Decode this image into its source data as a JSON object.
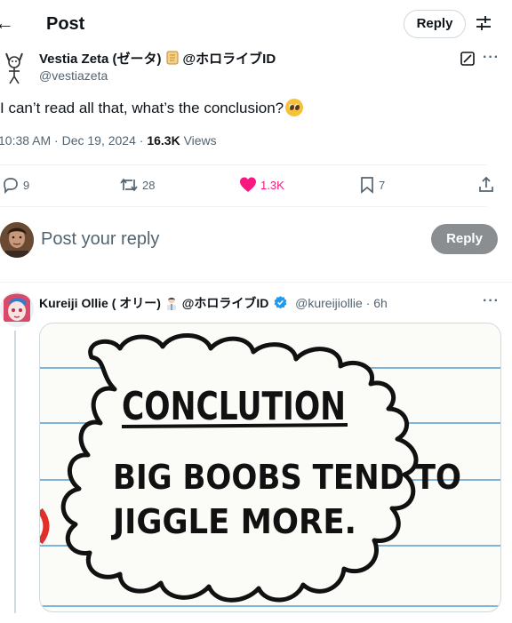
{
  "header": {
    "back_icon": "arrow-left-icon",
    "title": "Post",
    "reply_label": "Reply",
    "filter_icon": "sliders-icon"
  },
  "post": {
    "author_name": "Vestia Zeta (ゼータ)",
    "author_suffix": "@ホロライブID",
    "handle": "@vestiazeta",
    "text": "I can’t read all that, what’s the conclusion?",
    "emoji": "pleading-face",
    "timestamp": "10:38 AM · Dec 19, 2024 · ",
    "views_count": "16.3K",
    "views_label": " Views",
    "actions": {
      "replies": "9",
      "reposts": "28",
      "likes": "1.3K",
      "bookmarks": "7"
    }
  },
  "composer": {
    "placeholder": "Post your reply",
    "reply_button": "Reply"
  },
  "reply": {
    "author_name": "Kureiji Ollie ( オリー)",
    "author_suffix": "@ホロライブID",
    "handle": "@kureijiollie",
    "time": " · 6h",
    "image": {
      "heading": "CONCLUTION",
      "line1": "BIG BOOBS TEND TO",
      "line2": "JIGGLE MORE."
    }
  },
  "colors": {
    "like": "#f91880",
    "verified": "#1d9bf0",
    "muted": "#536471",
    "reply_button": "#8b8e90"
  }
}
